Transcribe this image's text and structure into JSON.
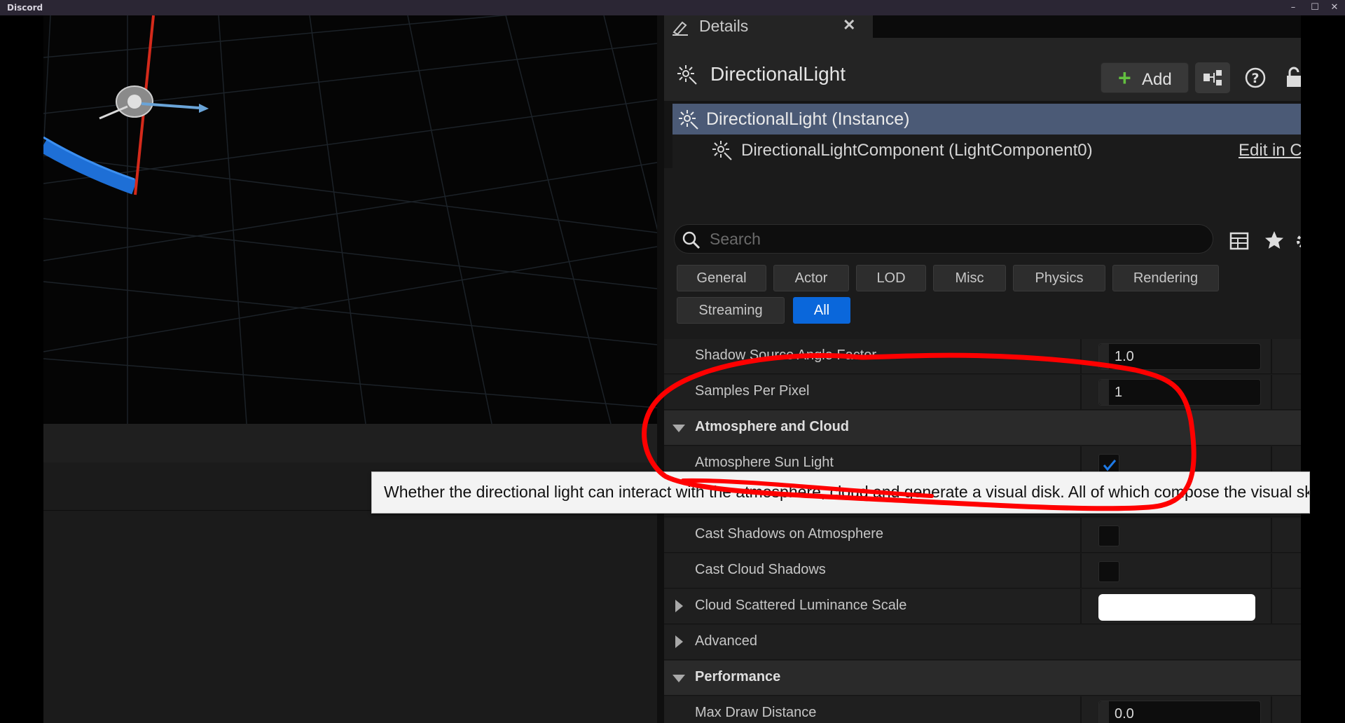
{
  "window": {
    "app_name": "Discord",
    "minimize": "–",
    "maximize": "☐",
    "close": "✕"
  },
  "details": {
    "tab_label": "Details",
    "tab_close": "✕",
    "actor_name": "DirectionalLight",
    "add_label": "Add",
    "tree": {
      "instance_label": "DirectionalLight (Instance)",
      "component_label": "DirectionalLightComponent (LightComponent0)",
      "edit_link": "Edit in C++"
    },
    "search": {
      "placeholder": "Search",
      "value": ""
    },
    "filters": [
      "General",
      "Actor",
      "LOD",
      "Misc",
      "Physics",
      "Rendering",
      "Streaming",
      "All"
    ],
    "active_filter": "All",
    "properties": {
      "shadow_source_angle_factor": {
        "label": "Shadow Source Angle Factor",
        "value": "1.0"
      },
      "samples_per_pixel": {
        "label": "Samples Per Pixel",
        "value": "1"
      },
      "atmosphere_and_cloud": {
        "label": "Atmosphere and Cloud"
      },
      "atmosphere_sun_light": {
        "label": "Atmosphere Sun Light",
        "checked": true
      },
      "cast_shadows_on_atmosphere": {
        "label": "Cast Shadows on Atmosphere",
        "checked": false
      },
      "cast_cloud_shadows": {
        "label": "Cast Cloud Shadows",
        "checked": false
      },
      "cloud_scattered_luminance_scale": {
        "label": "Cloud Scattered Luminance Scale",
        "color": "#ffffff"
      },
      "advanced": {
        "label": "Advanced"
      },
      "performance": {
        "label": "Performance"
      },
      "max_draw_distance": {
        "label": "Max Draw Distance",
        "value": "0.0"
      }
    },
    "tooltip": "Whether the directional light can interact with the atmosphere, cloud and generate a visual disk. All of which compose the visual sky."
  },
  "colors": {
    "selected_row": "#4b5a76",
    "active_filter": "#0a67db",
    "add_plus": "#63c040",
    "annotation_red": "#ff0000",
    "checkmark": "#1e7ae6"
  }
}
